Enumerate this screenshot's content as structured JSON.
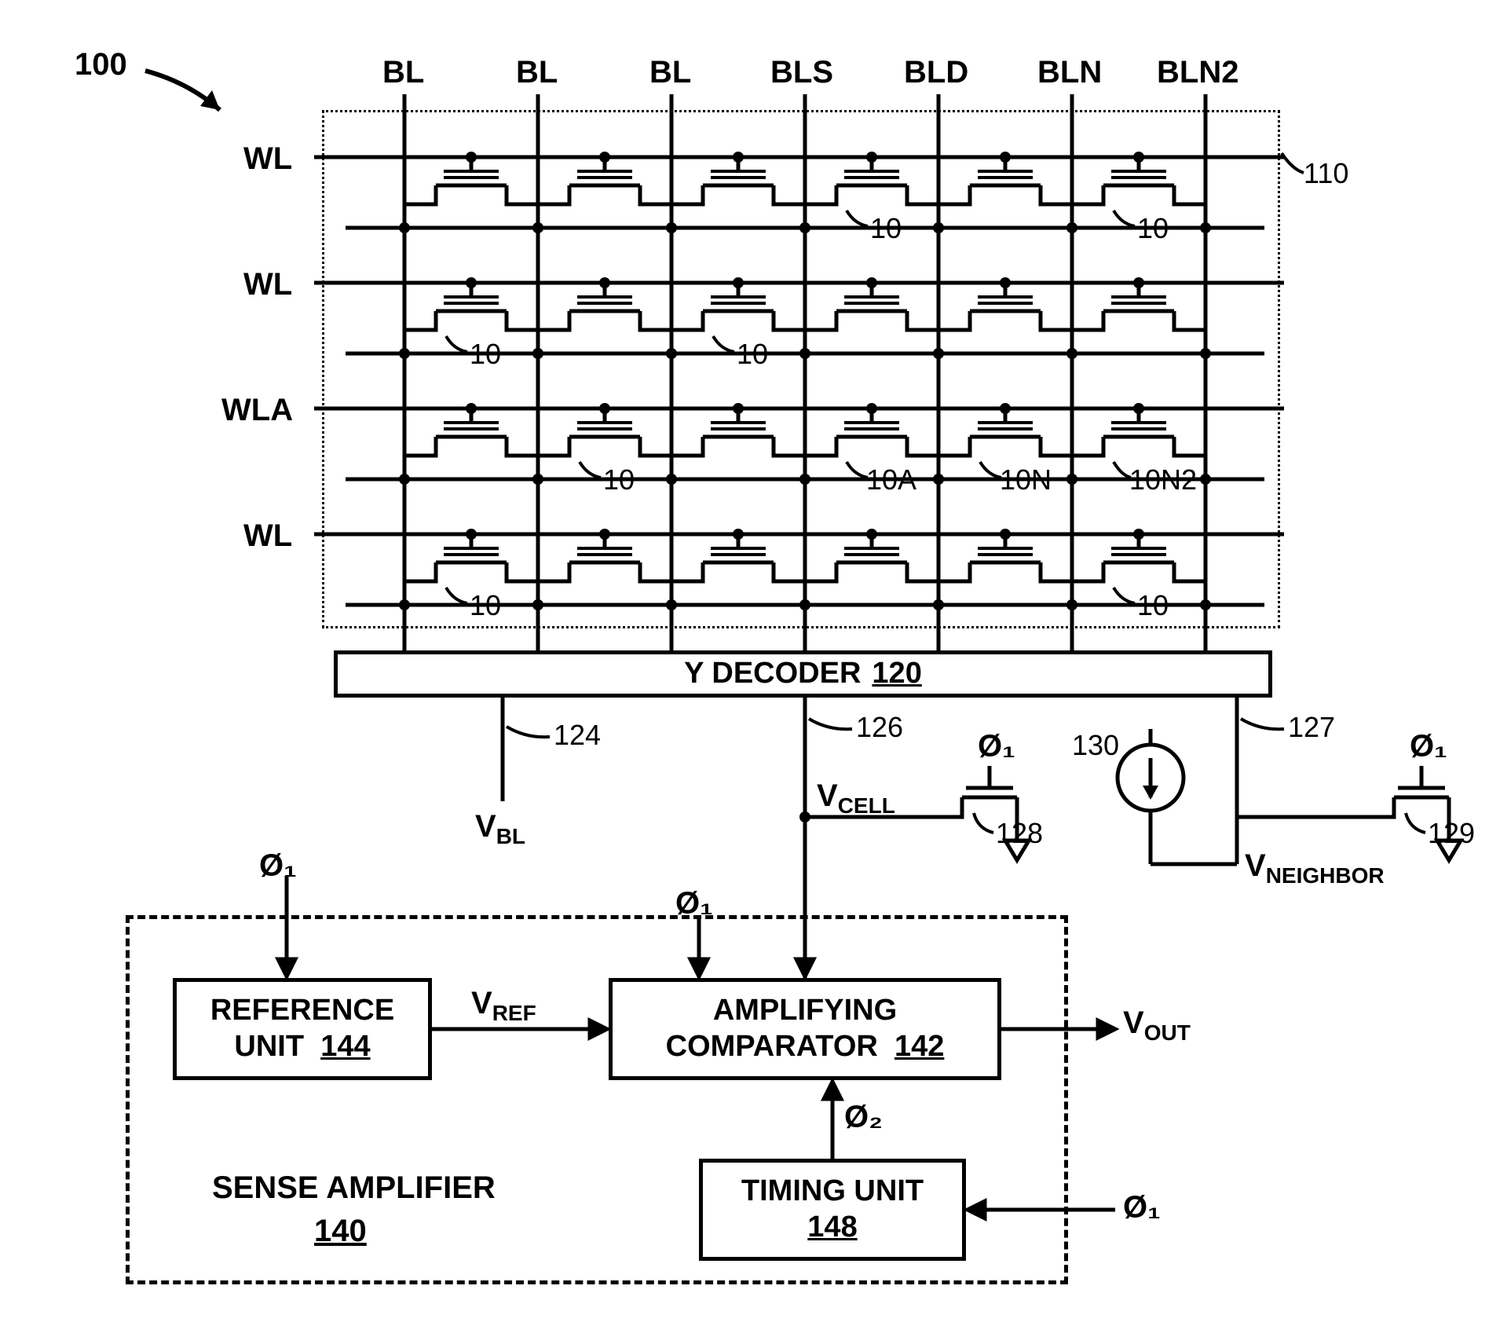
{
  "fig_ref": "100",
  "array_ref": "110",
  "bitlines": [
    "BL",
    "BL",
    "BL",
    "BLS",
    "BLD",
    "BLN",
    "BLN2"
  ],
  "wordlines": [
    "WL",
    "WL",
    "WLA",
    "WL"
  ],
  "cell_labels": {
    "row0": [
      "",
      "",
      "",
      "",
      "10",
      "",
      "10"
    ],
    "row1": [
      "10",
      "",
      "10",
      "",
      "",
      "",
      ""
    ],
    "row2": [
      "",
      "10",
      "",
      "10A",
      "10N",
      "10N2",
      ""
    ],
    "row3": [
      "10",
      "",
      "",
      "",
      "",
      "10",
      ""
    ]
  },
  "decoder": {
    "title": "Y DECODER",
    "ref": "120"
  },
  "lines": {
    "l124": {
      "ref": "124",
      "name": "V",
      "sub": "BL"
    },
    "l126": {
      "ref": "126",
      "name": "V",
      "sub": "CELL"
    },
    "l127": {
      "ref": "127"
    },
    "t128": {
      "ref": "128"
    },
    "t129": {
      "ref": "129"
    },
    "cs130": {
      "ref": "130"
    },
    "vneighbor": {
      "name": "V",
      "sub": "NEIGHBOR"
    }
  },
  "phi1": "Ø₁",
  "phi2": "Ø₂",
  "sense_amp": {
    "title": "SENSE AMPLIFIER",
    "ref": "140"
  },
  "ref_unit": {
    "title": "REFERENCE UNIT",
    "ref": "144"
  },
  "comparator": {
    "title": "AMPLIFYING COMPARATOR",
    "ref": "142"
  },
  "timing": {
    "title": "TIMING UNIT",
    "ref": "148"
  },
  "vref": {
    "name": "V",
    "sub": "REF"
  },
  "vout": {
    "name": "V",
    "sub": "OUT"
  }
}
